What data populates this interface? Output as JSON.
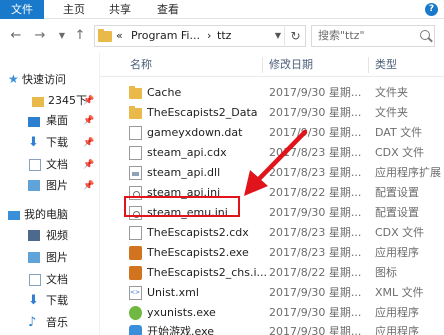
{
  "ribbon": {
    "tabs": [
      "文件",
      "主页",
      "共享",
      "查看"
    ],
    "help_icon": "help-icon"
  },
  "address": {
    "crumbs": [
      "«",
      "Program Fi...",
      "›",
      "ttz"
    ],
    "search_placeholder": "搜索\"ttz\""
  },
  "sidebar": {
    "items": [
      {
        "label": "快速访问",
        "icon": "star-icon",
        "pinned": false
      },
      {
        "label": "2345下",
        "icon": "folder-icon",
        "pinned": true
      },
      {
        "label": "桌面",
        "icon": "desktop-icon",
        "pinned": true
      },
      {
        "label": "下载",
        "icon": "download-icon",
        "pinned": true
      },
      {
        "label": "文档",
        "icon": "document-icon",
        "pinned": true
      },
      {
        "label": "图片",
        "icon": "picture-icon",
        "pinned": true
      },
      {
        "label": "我的电脑",
        "icon": "computer-icon",
        "pinned": false
      },
      {
        "label": "视频",
        "icon": "video-icon",
        "pinned": false
      },
      {
        "label": "图片",
        "icon": "picture-icon",
        "pinned": false
      },
      {
        "label": "文档",
        "icon": "document-icon",
        "pinned": false
      },
      {
        "label": "下载",
        "icon": "download-icon",
        "pinned": false
      },
      {
        "label": "音乐",
        "icon": "music-icon",
        "pinned": false
      }
    ]
  },
  "columns": {
    "name": "名称",
    "date": "修改日期",
    "type": "类型"
  },
  "files": [
    {
      "name": "Cache",
      "date": "2017/9/30 星期...",
      "type": "文件夹",
      "icon": "folder"
    },
    {
      "name": "TheEscapists2_Data",
      "date": "2017/9/30 星期...",
      "type": "文件夹",
      "icon": "folder"
    },
    {
      "name": "gameyxdown.dat",
      "date": "2017/9/30 星期...",
      "type": "DAT 文件",
      "icon": "file"
    },
    {
      "name": "steam_api.cdx",
      "date": "2017/8/23 星期...",
      "type": "CDX 文件",
      "icon": "file"
    },
    {
      "name": "steam_api.dll",
      "date": "2017/8/23 星期...",
      "type": "应用程序扩展",
      "icon": "dll"
    },
    {
      "name": "steam_api.ini",
      "date": "2017/8/22 星期...",
      "type": "配置设置",
      "icon": "cfg"
    },
    {
      "name": "steam_emu.ini",
      "date": "2017/9/30 星期...",
      "type": "配置设置",
      "icon": "cfg"
    },
    {
      "name": "TheEscapists2.cdx",
      "date": "2017/8/23 星期...",
      "type": "CDX 文件",
      "icon": "file"
    },
    {
      "name": "TheEscapists2.exe",
      "date": "2017/8/23 星期...",
      "type": "应用程序",
      "icon": "exe"
    },
    {
      "name": "TheEscapists2_chs.i...",
      "date": "2017/8/22 星期...",
      "type": "图标",
      "icon": "img"
    },
    {
      "name": "Unist.xml",
      "date": "2017/9/30 星期...",
      "type": "XML 文件",
      "icon": "xml"
    },
    {
      "name": "yxunists.exe",
      "date": "2017/9/30 星期...",
      "type": "应用程序",
      "icon": "uni"
    },
    {
      "name": "开始游戏.exe",
      "date": "2017/9/30 星期...",
      "type": "应用程序",
      "icon": "game"
    }
  ],
  "colors": {
    "accent": "#1979ca",
    "highlight_box": "#e0141a",
    "selection": "#cce8ff"
  }
}
